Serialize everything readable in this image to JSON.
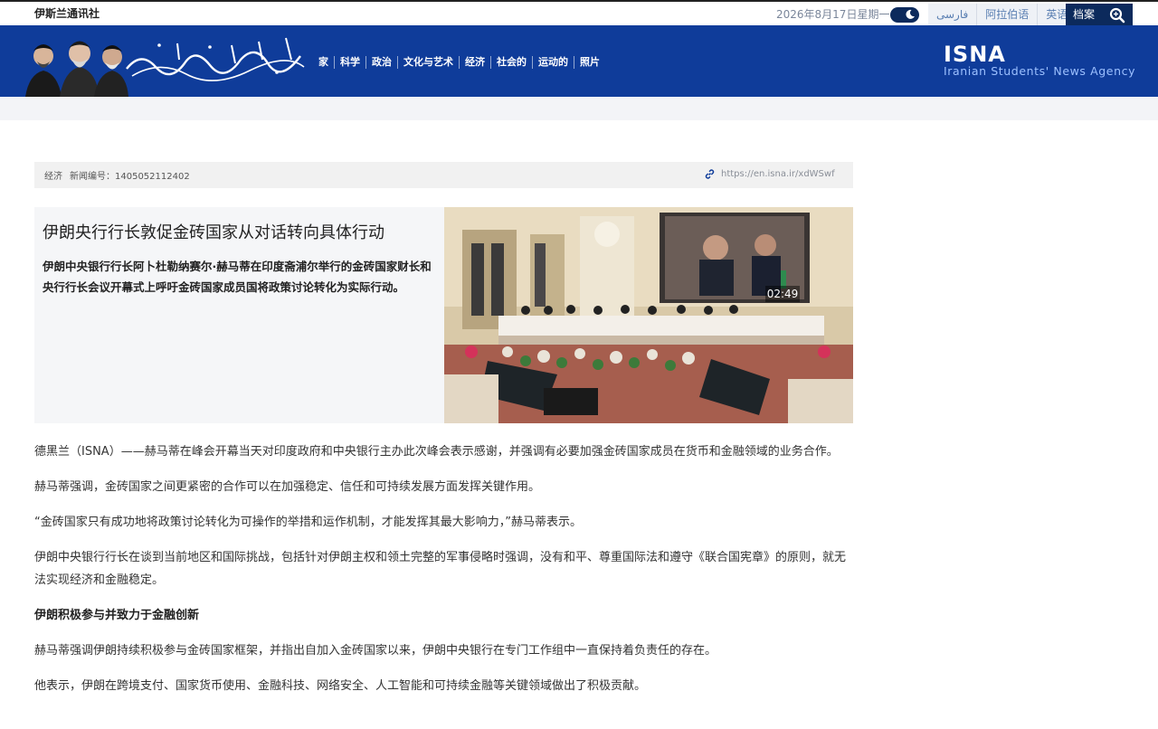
{
  "topbar": {
    "site_name": "伊斯兰通讯社",
    "date": "2026年8月17日星期一",
    "languages": [
      "فارسی",
      "阿拉伯语",
      "英语"
    ],
    "archive": "档案"
  },
  "header": {
    "nav": [
      "家",
      "科学",
      "政治",
      "文化与艺术",
      "经济",
      "社会的",
      "运动的",
      "照片"
    ],
    "brand_short": "ISNA",
    "brand_full": "Iranian Students' News Agency"
  },
  "meta": {
    "category": "经济",
    "news_id": "新闻编号：1405052112402",
    "short_link": "https://en.isna.ir/xdWSwf"
  },
  "lead": {
    "headline": "伊朗央行行长敦促金砖国家从对话转向具体行动",
    "summary": "伊朗中央银行行长阿卜杜勒纳赛尔·赫马蒂在印度斋浦尔举行的金砖国家财长和央行行长会议开幕式上呼吁金砖国家成员国将政策讨论转化为实际行动。",
    "video_duration": "02:49"
  },
  "article": {
    "p1": "德黑兰（ISNA）——赫马蒂在峰会开幕当天对印度政府和中央银行主办此次峰会表示感谢，并强调有必要加强金砖国家成员在货币和金融领域的业务合作。",
    "p2": "赫马蒂强调，金砖国家之间更紧密的合作可以在加强稳定、信任和可持续发展方面发挥关键作用。",
    "p3": "“金砖国家只有成功地将政策讨论转化为可操作的举措和运作机制，才能发挥其最大影响力，”赫马蒂表示。",
    "p4": "伊朗中央银行行长在谈到当前地区和国际挑战，包括针对伊朗主权和领土完整的军事侵略时强调，没有和平、尊重国际法和遵守《联合国宪章》的原则，就无法实现经济和金融稳定。",
    "subhead": "伊朗积极参与并致力于金融创新",
    "p5": "赫马蒂强调伊朗持续积极参与金砖国家框架，并指出自加入金砖国家以来，伊朗中央银行在专门工作组中一直保持着负责任的存在。",
    "p6": "他表示，伊朗在跨境支付、国家货币使用、金融科技、网络安全、人工智能和可持续金融等关键领域做出了积极贡献。"
  },
  "colors": {
    "header_blue": "#0f3c9a",
    "dark_navy": "#0c2a5c",
    "brand_sub": "#9cc0ff"
  },
  "icons": [
    "moon-icon",
    "search-icon",
    "link-icon"
  ]
}
